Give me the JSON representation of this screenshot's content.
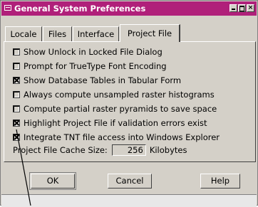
{
  "window": {
    "title": "General System Preferences",
    "titlebar_color": "#b0207a"
  },
  "tabs": [
    {
      "label": "Locale",
      "active": false
    },
    {
      "label": "Files",
      "active": false
    },
    {
      "label": "Interface",
      "active": false
    },
    {
      "label": "Project File",
      "active": true
    }
  ],
  "options": [
    {
      "label": "Show Unlock in Locked File Dialog",
      "checked": false
    },
    {
      "label": "Prompt for TrueType Font Encoding",
      "checked": false
    },
    {
      "label": "Show Database Tables in Tabular Form",
      "checked": true
    },
    {
      "label": "Always compute unsampled raster histograms",
      "checked": false
    },
    {
      "label": "Compute partial raster pyramids to save space",
      "checked": false
    },
    {
      "label": "Highlight Project File if validation errors exist",
      "checked": true
    },
    {
      "label": "Integrate TNT file access into Windows Explorer",
      "checked": true
    }
  ],
  "cache": {
    "label": "Project File Cache Size:",
    "value": "256",
    "unit": "Kilobytes"
  },
  "buttons": {
    "ok": "OK",
    "cancel": "Cancel",
    "help": "Help"
  }
}
